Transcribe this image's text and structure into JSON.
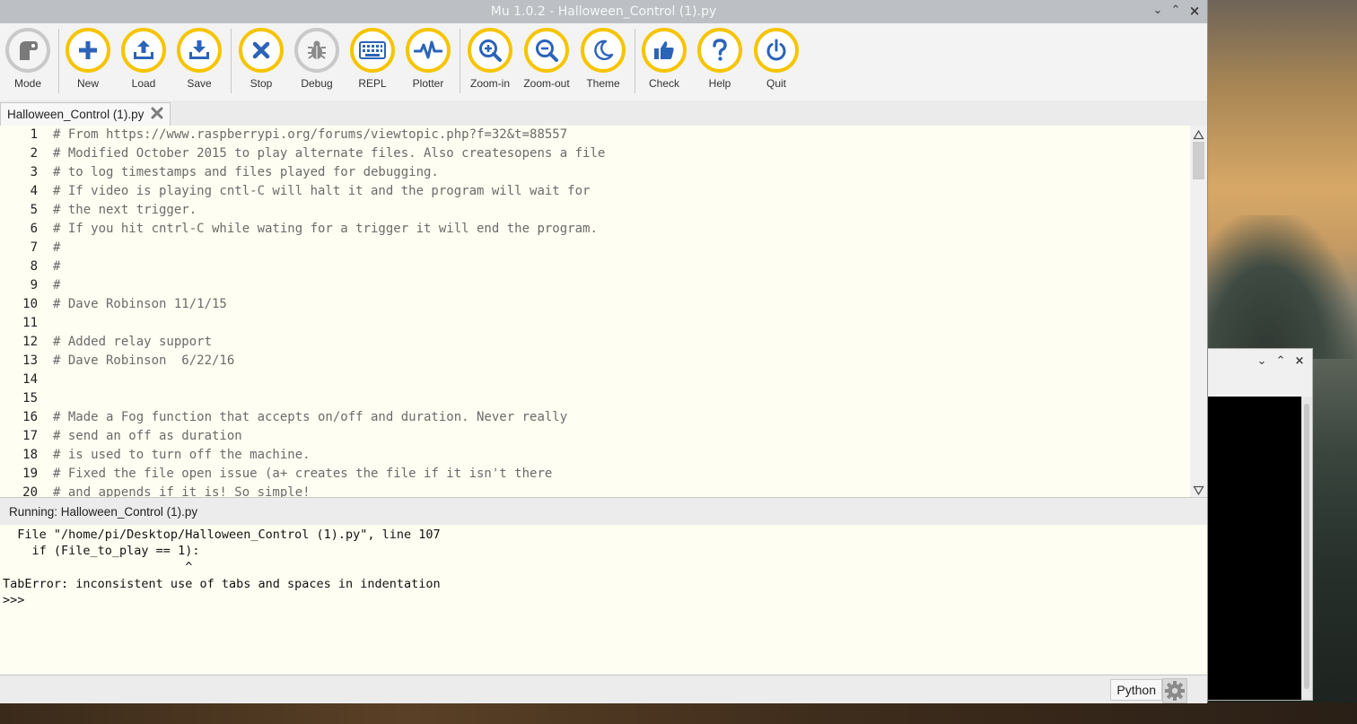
{
  "window": {
    "title": "Mu 1.0.2 - Halloween_Control (1).py"
  },
  "toolbar": {
    "buttons": [
      {
        "label": "Mode",
        "icon": "mode-icon"
      },
      {
        "label": "New",
        "icon": "plus-icon"
      },
      {
        "label": "Load",
        "icon": "upload-icon"
      },
      {
        "label": "Save",
        "icon": "download-icon"
      },
      {
        "label": "Stop",
        "icon": "close-icon"
      },
      {
        "label": "Debug",
        "icon": "bug-icon"
      },
      {
        "label": "REPL",
        "icon": "keyboard-icon"
      },
      {
        "label": "Plotter",
        "icon": "pulse-icon"
      },
      {
        "label": "Zoom-in",
        "icon": "zoom-in-icon"
      },
      {
        "label": "Zoom-out",
        "icon": "zoom-out-icon"
      },
      {
        "label": "Theme",
        "icon": "moon-icon"
      },
      {
        "label": "Check",
        "icon": "thumbs-up-icon"
      },
      {
        "label": "Help",
        "icon": "question-icon"
      },
      {
        "label": "Quit",
        "icon": "power-icon"
      }
    ]
  },
  "tabs": [
    {
      "label": "Halloween_Control (1).py"
    }
  ],
  "editor": {
    "lines": [
      {
        "n": "1",
        "text": "# From https://www.raspberrypi.org/forums/viewtopic.php?f=32&t=88557"
      },
      {
        "n": "2",
        "text": "# Modified October 2015 to play alternate files. Also createsopens a file"
      },
      {
        "n": "3",
        "text": "# to log timestamps and files played for debugging."
      },
      {
        "n": "4",
        "text": "# If video is playing cntl-C will halt it and the program will wait for"
      },
      {
        "n": "5",
        "text": "# the next trigger."
      },
      {
        "n": "6",
        "text": "# If you hit cntrl-C while wating for a trigger it will end the program."
      },
      {
        "n": "7",
        "text": "#"
      },
      {
        "n": "8",
        "text": "#"
      },
      {
        "n": "9",
        "text": "#"
      },
      {
        "n": "10",
        "text": "# Dave Robinson 11/1/15"
      },
      {
        "n": "11",
        "text": ""
      },
      {
        "n": "12",
        "text": "# Added relay support"
      },
      {
        "n": "13",
        "text": "# Dave Robinson  6/22/16"
      },
      {
        "n": "14",
        "text": ""
      },
      {
        "n": "15",
        "text": ""
      },
      {
        "n": "16",
        "text": "# Made a Fog function that accepts on/off and duration. Never really"
      },
      {
        "n": "17",
        "text": "# send an off as duration"
      },
      {
        "n": "18",
        "text": "# is used to turn off the machine."
      },
      {
        "n": "19",
        "text": "# Fixed the file open issue (a+ creates the file if it isn't there"
      },
      {
        "n": "20",
        "text": "# and appends if it is! So simple!"
      }
    ]
  },
  "pane": {
    "header": "Running: Halloween_Control (1).py"
  },
  "repl": {
    "lines": [
      "  File \"/home/pi/Desktop/Halloween_Control (1).py\", line 107",
      "    if (File_to_play == 1):",
      "                         ^",
      "TabError: inconsistent use of tabs and spaces in indentation",
      ">>> "
    ]
  },
  "status": {
    "mode": "Python"
  },
  "colors": {
    "accent": "#f6c400",
    "editor_bg": "#fefef2",
    "icon_blue": "#2b63b8"
  }
}
